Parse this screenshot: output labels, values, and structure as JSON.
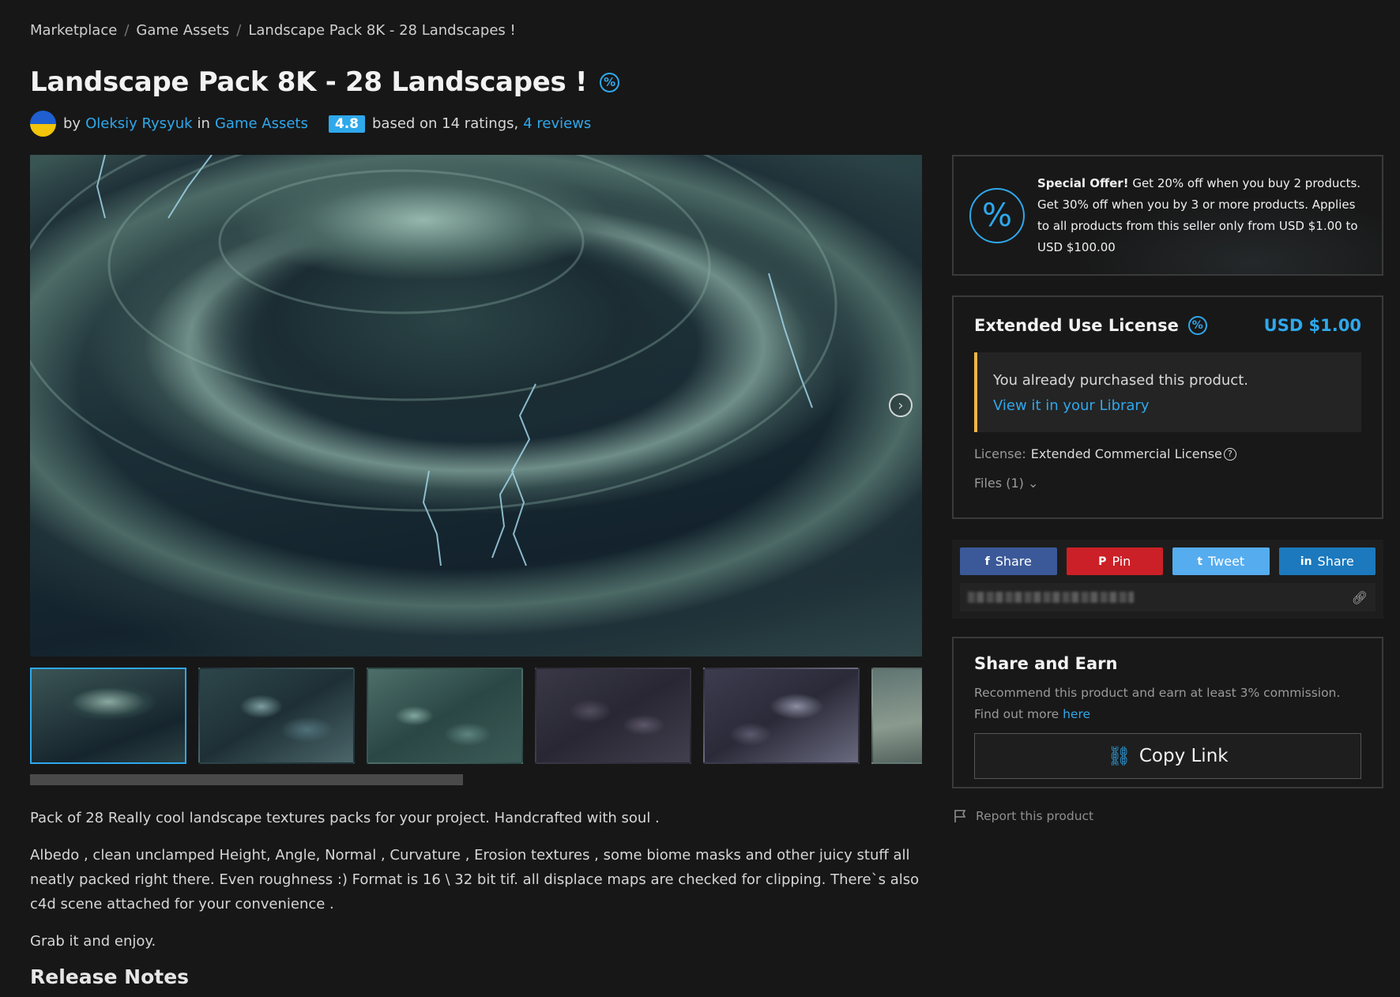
{
  "breadcrumb": {
    "items": [
      "Marketplace",
      "Game Assets",
      "Landscape Pack 8K - 28 Landscapes !"
    ],
    "separator": "/"
  },
  "product": {
    "title": "Landscape Pack 8K - 28 Landscapes !",
    "discount_icon": "percent-badge-icon",
    "by_label": "by",
    "author": "Oleksiy Rysyuk",
    "in_label": "in",
    "category": "Game Assets",
    "rating": "4.8",
    "ratings_text": "based on 14 ratings,",
    "reviews_link": "4 reviews"
  },
  "gallery": {
    "thumbnail_count": 6,
    "active_index": 0,
    "next_icon": "chevron-right-circle-icon"
  },
  "description": {
    "p1": "Pack of 28 Really cool landscape textures packs for your project. Handcrafted with soul .",
    "p2": "Albedo , clean unclamped Height, Angle, Normal , Curvature , Erosion textures , some biome masks and other juicy stuff all neatly packed right there. Even roughness :) Format is 16 \\ 32 bit tif. all displace maps are checked for clipping. There`s also c4d scene attached for your convenience .",
    "p3": "Grab it and enjoy.",
    "release_notes": "Release Notes"
  },
  "offer": {
    "icon_glyph": "%",
    "bold": "Special Offer!",
    "text": " Get 20% off when you buy 2 products. Get 30% off when you by 3 or more products. Applies to all products from this seller only from USD $1.00 to USD $100.00"
  },
  "license": {
    "title": "Extended Use License",
    "price": "USD $1.00",
    "purchased_text": "You already purchased this product.",
    "library_link": "View it in your Library",
    "license_label": "License:",
    "license_value": "Extended Commercial License",
    "files_label": "Files (1)"
  },
  "share": {
    "facebook": "Share",
    "pinterest": "Pin",
    "twitter": "Tweet",
    "linkedin": "Share"
  },
  "earn": {
    "title": "Share and Earn",
    "text": "Recommend this product and earn at least 3% commission. Find out more ",
    "here_link": "here",
    "copy_button": "Copy Link"
  },
  "report": {
    "label": "Report this product"
  },
  "colors": {
    "accent": "#2fa8ec",
    "background": "#171717",
    "warning": "#f0b548"
  }
}
